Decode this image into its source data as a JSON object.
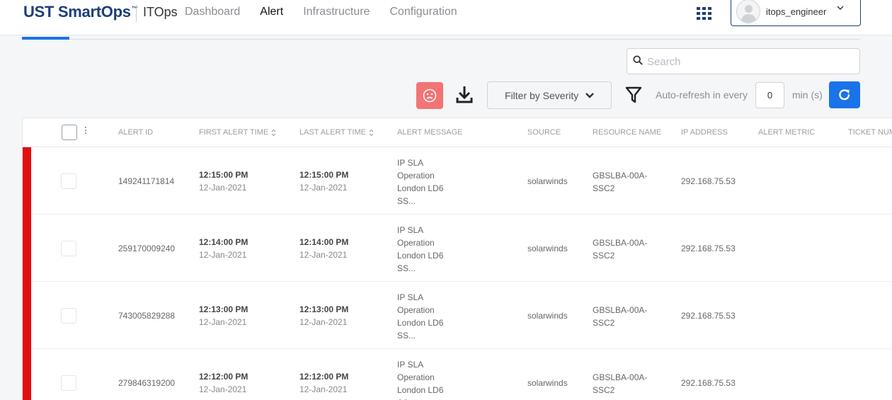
{
  "header": {
    "brand": "UST SmartOps",
    "brand_mark": "™",
    "product": "ITOps",
    "nav": [
      {
        "label": "Dashboard"
      },
      {
        "label": "Alert"
      },
      {
        "label": "Infrastructure"
      },
      {
        "label": "Configuration"
      }
    ],
    "active_nav": "Alert",
    "user": {
      "name": "itops_engineer"
    }
  },
  "search": {
    "placeholder": "Search",
    "value": ""
  },
  "toolbar": {
    "severity_filter_label": "Filter by Severity",
    "auto_refresh_label": "Auto-refresh in every",
    "auto_refresh_value": "0",
    "auto_refresh_unit": "min (s)"
  },
  "table": {
    "columns": [
      {
        "label": "ALERT ID",
        "sortable": false
      },
      {
        "label": "FIRST ALERT TIME",
        "sortable": true
      },
      {
        "label": "LAST ALERT TIME",
        "sortable": true
      },
      {
        "label": "ALERT MESSAGE",
        "sortable": false
      },
      {
        "label": "SOURCE",
        "sortable": false
      },
      {
        "label": "RESOURCE NAME",
        "sortable": false
      },
      {
        "label": "IP ADDRESS",
        "sortable": false
      },
      {
        "label": "ALERT METRIC",
        "sortable": false
      },
      {
        "label": "TICKET NUM",
        "sortable": false
      }
    ],
    "severity_color": "#e30f0f",
    "rows": [
      {
        "alert_id": "149241171814",
        "first_time": "12:15:00 PM",
        "first_date": "12-Jan-2021",
        "last_time": "12:15:00 PM",
        "last_date": "12-Jan-2021",
        "message": "IP SLA\nOperation\nLondon LD6\nSS...",
        "source": "solarwinds",
        "resource": "GBSLBA-00A-\nSSC2",
        "ip": "292.168.75.53"
      },
      {
        "alert_id": "259170009240",
        "first_time": "12:14:00 PM",
        "first_date": "12-Jan-2021",
        "last_time": "12:14:00 PM",
        "last_date": "12-Jan-2021",
        "message": "IP SLA\nOperation\nLondon LD6\nSS...",
        "source": "solarwinds",
        "resource": "GBSLBA-00A-\nSSC2",
        "ip": "292.168.75.53"
      },
      {
        "alert_id": "743005829288",
        "first_time": "12:13:00 PM",
        "first_date": "12-Jan-2021",
        "last_time": "12:13:00 PM",
        "last_date": "12-Jan-2021",
        "message": "IP SLA\nOperation\nLondon LD6\nSS...",
        "source": "solarwinds",
        "resource": "GBSLBA-00A-\nSSC2",
        "ip": "292.168.75.53"
      },
      {
        "alert_id": "279846319200",
        "first_time": "12:12:00 PM",
        "first_date": "12-Jan-2021",
        "last_time": "12:12:00 PM",
        "last_date": "12-Jan-2021",
        "message": "IP SLA\nOperation\nLondon LD6\nSS...",
        "source": "solarwinds",
        "resource": "GBSLBA-00A-\nSSC2",
        "ip": "292.168.75.53"
      }
    ]
  },
  "colors": {
    "brand": "#1c3f78",
    "accent": "#1a73e8",
    "critical": "#e30f0f",
    "sad_button": "#f27474"
  },
  "icons": [
    "apps-grid-icon",
    "user-avatar-icon",
    "chevron-down-icon",
    "search-icon",
    "sad-face-icon",
    "download-icon",
    "filter-icon",
    "refresh-icon",
    "sort-icon",
    "kebab-menu-icon"
  ]
}
